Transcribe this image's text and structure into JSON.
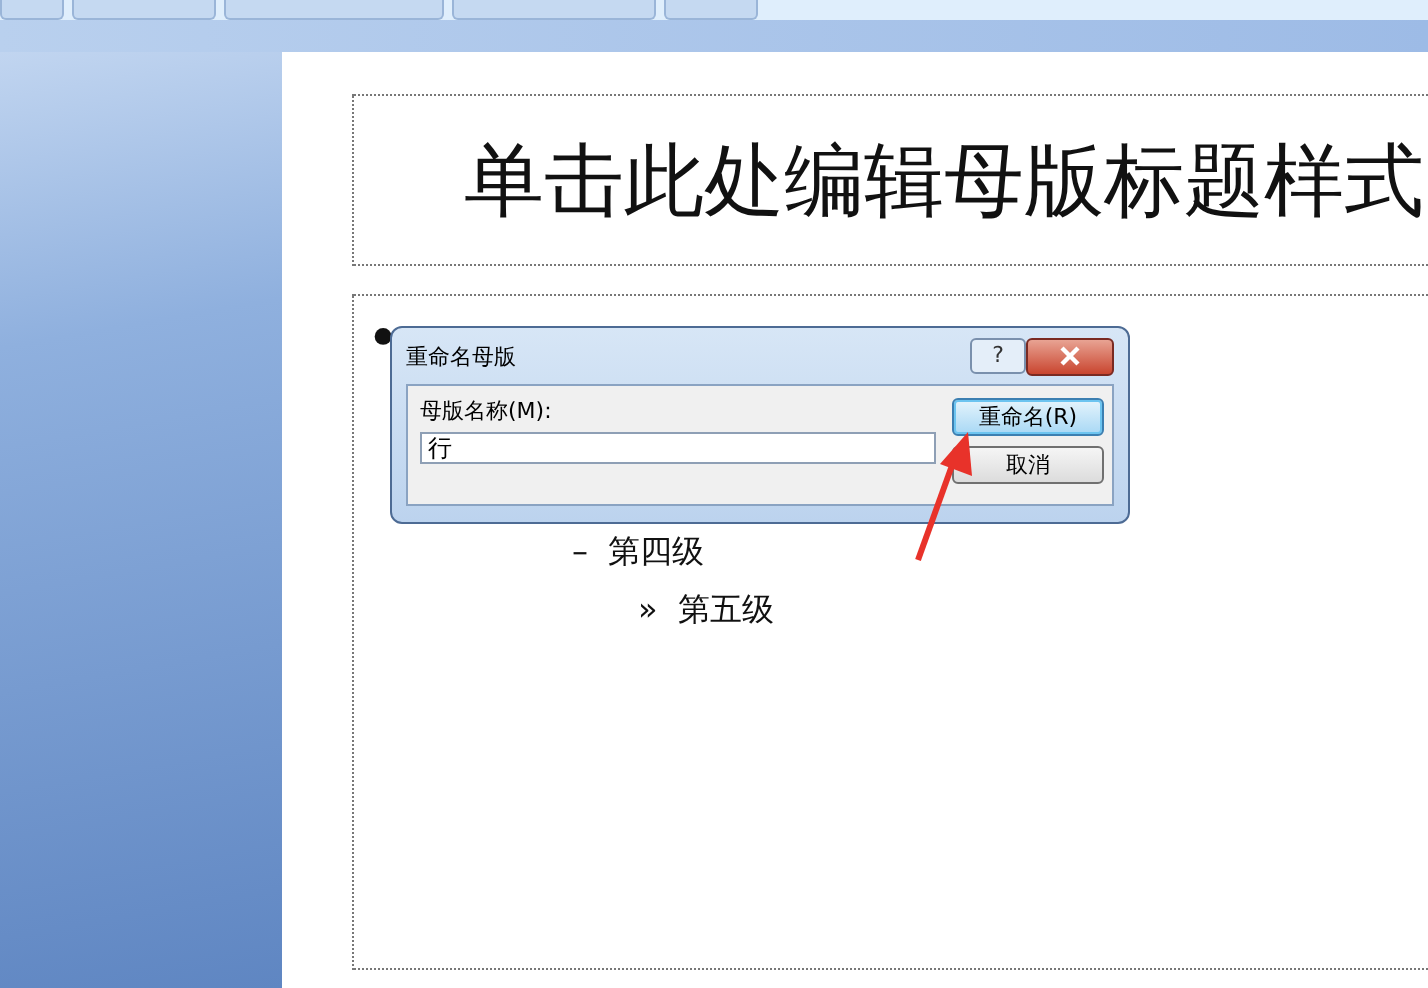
{
  "slide": {
    "title": "单击此处编辑母版标题样式",
    "levels": [
      {
        "kind": "first",
        "bullet": "•"
      },
      {
        "kind": "fourth",
        "bullet": "–",
        "text": "第四级"
      },
      {
        "kind": "fifth",
        "bullet": "»",
        "text": "第五级"
      }
    ]
  },
  "dialog": {
    "title": "重命名母版",
    "help": "?",
    "field_label": "母版名称(M):",
    "field_value": "行",
    "buttons": [
      {
        "label": "重命名(R)",
        "default": true
      },
      {
        "label": "取消",
        "default": false
      }
    ]
  }
}
